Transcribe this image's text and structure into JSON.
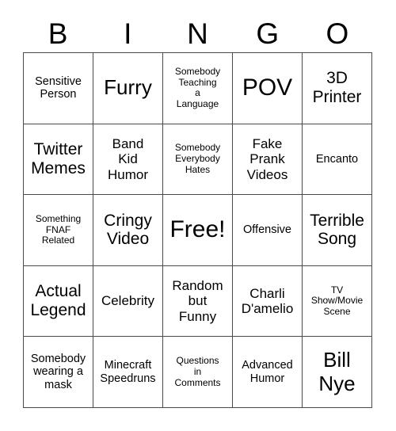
{
  "colors": {
    "background": "#ffffff",
    "text": "#000000",
    "grid_border": "#4a4a4a"
  },
  "header": {
    "letters": [
      "B",
      "I",
      "N",
      "G",
      "O"
    ]
  },
  "grid": {
    "rows": 5,
    "columns": 5,
    "cells": [
      [
        {
          "text": "Sensitive\nPerson",
          "size": "s"
        },
        {
          "text": "Furry",
          "size": "xl"
        },
        {
          "text": "Somebody\nTeaching\na\nLanguage",
          "size": "xs"
        },
        {
          "text": "POV",
          "size": "xxl"
        },
        {
          "text": "3D\nPrinter",
          "size": "l"
        }
      ],
      [
        {
          "text": "Twitter\nMemes",
          "size": "l"
        },
        {
          "text": "Band\nKid\nHumor",
          "size": "m"
        },
        {
          "text": "Somebody\nEverybody\nHates",
          "size": "xs"
        },
        {
          "text": "Fake\nPrank\nVideos",
          "size": "m"
        },
        {
          "text": "Encanto",
          "size": "s"
        }
      ],
      [
        {
          "text": "Something\nFNAF\nRelated",
          "size": "xs"
        },
        {
          "text": "Cringy\nVideo",
          "size": "l"
        },
        {
          "text": "Free!",
          "size": "xxl"
        },
        {
          "text": "Offensive",
          "size": "s"
        },
        {
          "text": "Terrible\nSong",
          "size": "l"
        }
      ],
      [
        {
          "text": "Actual\nLegend",
          "size": "l"
        },
        {
          "text": "Celebrity",
          "size": "m"
        },
        {
          "text": "Random\nbut\nFunny",
          "size": "m"
        },
        {
          "text": "Charli\nD'amelio",
          "size": "m"
        },
        {
          "text": "TV\nShow/Movie\nScene",
          "size": "xs"
        }
      ],
      [
        {
          "text": "Somebody\nwearing a\nmask",
          "size": "s"
        },
        {
          "text": "Minecraft\nSpeedruns",
          "size": "s"
        },
        {
          "text": "Questions\nin\nComments",
          "size": "xs"
        },
        {
          "text": "Advanced\nHumor",
          "size": "s"
        },
        {
          "text": "Bill\nNye",
          "size": "xl"
        }
      ]
    ]
  }
}
